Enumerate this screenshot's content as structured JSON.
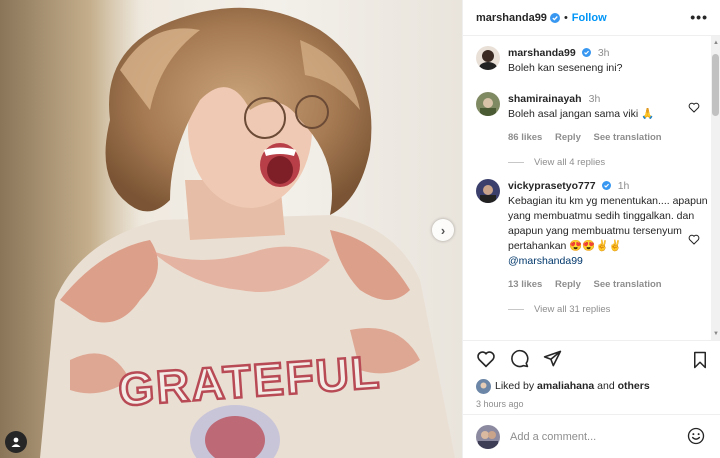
{
  "header": {
    "username": "marshanda99",
    "follow_label": "Follow",
    "more_label": "•••"
  },
  "caption": {
    "username": "marshanda99",
    "time": "3h",
    "text": "Boleh kan seseneng ini?"
  },
  "comments": [
    {
      "username": "shamirainayah",
      "time": "3h",
      "text": "Boleh asal jangan sama viki 🙏",
      "likes": "86 likes",
      "reply_label": "Reply",
      "translate_label": "See translation",
      "view_replies": "View all 4 replies"
    },
    {
      "username": "vickyprasetyo777",
      "time": "1h",
      "text": "Kebagian itu km yg menentukan.... apapun yang membuatmu sedih tinggalkan. dan apapun yang membuatmu tersenyum pertahankan 😍😍✌️✌️",
      "mention": "@marshanda99",
      "likes": "13 likes",
      "reply_label": "Reply",
      "translate_label": "See translation",
      "view_replies": "View all 31 replies"
    }
  ],
  "icons": {
    "heart": "heart-icon",
    "comment": "comment-icon",
    "share": "paper-plane-icon",
    "save": "bookmark-icon",
    "emoji": "smiley-icon",
    "verified": "verified-badge-icon",
    "next": "chevron-right-icon",
    "tag": "person-tag-icon"
  },
  "likes_line": {
    "prefix": "Liked by",
    "name": "amaliahana",
    "and": "and",
    "others": "others"
  },
  "time_ago": "3 hours ago",
  "add_comment": {
    "placeholder": "Add a comment..."
  },
  "colors": {
    "accent": "#0095f6",
    "verified": "#3897f0",
    "text": "#262626",
    "muted": "#8e8e8e"
  }
}
